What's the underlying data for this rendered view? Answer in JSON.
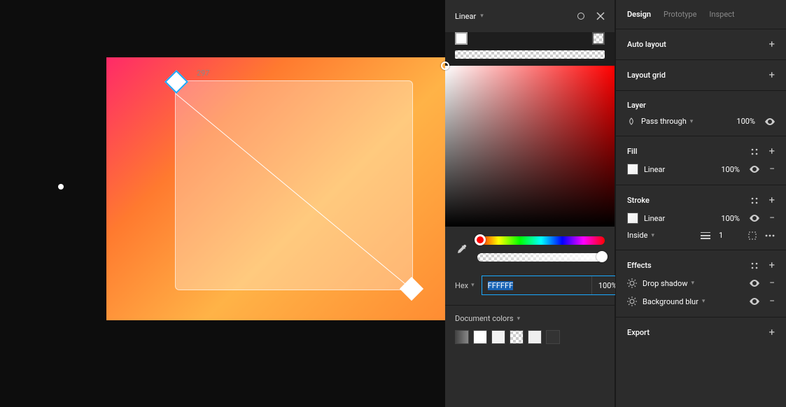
{
  "canvas": {
    "selection_size_label": "297"
  },
  "picker": {
    "title": "Linear",
    "hex_label": "Hex",
    "hex_value": "FFFFFF",
    "hex_alpha": "100%",
    "doc_colors_label": "Document colors"
  },
  "inspector": {
    "tabs": {
      "design": "Design",
      "prototype": "Prototype",
      "inspect": "Inspect"
    },
    "auto_layout": {
      "label": "Auto layout"
    },
    "layout_grid": {
      "label": "Layout grid"
    },
    "layer": {
      "label": "Layer",
      "blend": "Pass through",
      "opacity": "100%"
    },
    "fill": {
      "label": "Fill",
      "type": "Linear",
      "opacity": "100%"
    },
    "stroke": {
      "label": "Stroke",
      "type": "Linear",
      "opacity": "100%",
      "position": "Inside",
      "width": "1"
    },
    "effects": {
      "label": "Effects",
      "items": [
        {
          "name": "Drop shadow"
        },
        {
          "name": "Background blur"
        }
      ]
    },
    "export": {
      "label": "Export"
    }
  }
}
